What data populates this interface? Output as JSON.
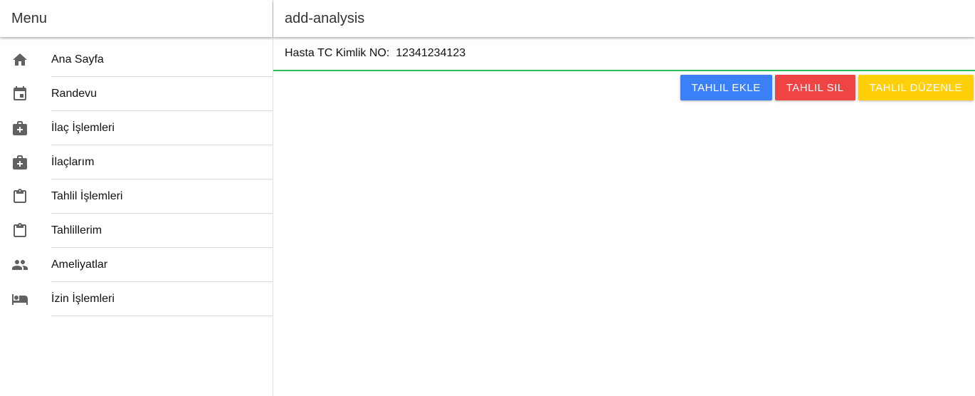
{
  "sidebar": {
    "title": "Menu",
    "items": [
      {
        "label": "Ana Sayfa",
        "icon": "home-icon"
      },
      {
        "label": "Randevu",
        "icon": "calendar-icon"
      },
      {
        "label": "İlaç İşlemleri",
        "icon": "medical-bag-icon"
      },
      {
        "label": "İlaçlarım",
        "icon": "medical-bag-icon"
      },
      {
        "label": "Tahlil İşlemleri",
        "icon": "clipboard-icon"
      },
      {
        "label": "Tahlillerim",
        "icon": "clipboard-icon"
      },
      {
        "label": "Ameliyatlar",
        "icon": "people-icon"
      },
      {
        "label": "İzin İşlemleri",
        "icon": "bed-icon"
      }
    ]
  },
  "header": {
    "title": "add-analysis"
  },
  "form": {
    "tc_label": "Hasta TC Kimlik NO:",
    "tc_value": "12341234123"
  },
  "actions": {
    "add_label": "Tahlil Ekle",
    "delete_label": "Tahlil Sil",
    "edit_label": "Tahlil Düzenle"
  },
  "colors": {
    "add": "#3b80f6",
    "delete": "#ef4444",
    "edit": "#ffcf0a",
    "input_underline": "#2ebd59"
  }
}
